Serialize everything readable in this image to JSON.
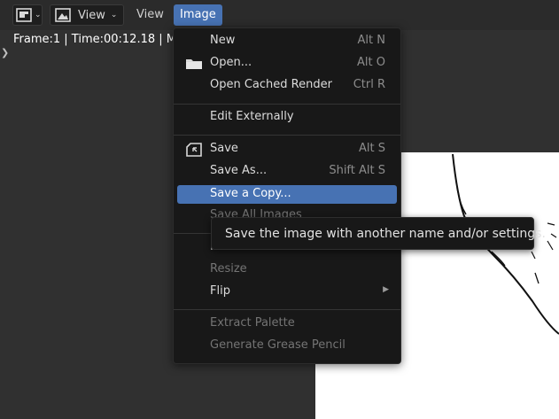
{
  "header": {
    "editor_type_icon": "image-editor-icon",
    "view_mode_icon": "image-view-icon",
    "view_mode_label": "View",
    "menus": [
      "View",
      "Image"
    ],
    "active_menu": "Image",
    "accent_color": "#4772b3"
  },
  "frame_info": "Frame:1 | Time:00:12.18 | M",
  "menu": {
    "items": [
      {
        "label": "New",
        "shortcut": "Alt N",
        "icon": ""
      },
      {
        "label": "Open...",
        "shortcut": "Alt O",
        "icon": "folder-icon"
      },
      {
        "label": "Open Cached Render",
        "shortcut": "Ctrl R",
        "icon": ""
      },
      {
        "label": "Edit Externally",
        "shortcut": "",
        "icon": ""
      },
      {
        "label": "Save",
        "shortcut": "Alt S",
        "icon": "save-icon"
      },
      {
        "label": "Save As...",
        "shortcut": "Shift Alt S",
        "icon": ""
      },
      {
        "label": "Save a Copy...",
        "shortcut": "",
        "icon": "",
        "highlighted": true
      },
      {
        "label": "Save All Images",
        "shortcut": "",
        "icon": "",
        "partially_hidden": true
      },
      {
        "label": "Invert",
        "shortcut": "",
        "icon": "",
        "submenu": true
      },
      {
        "label": "Resize",
        "shortcut": "",
        "icon": "",
        "disabled": true
      },
      {
        "label": "Flip",
        "shortcut": "",
        "icon": "",
        "submenu": true
      },
      {
        "label": "Extract Palette",
        "shortcut": "",
        "icon": "",
        "disabled": true
      },
      {
        "label": "Generate Grease Pencil",
        "shortcut": "",
        "icon": "",
        "disabled": true
      }
    ]
  },
  "tooltip": "Save the image with another name and/or settings."
}
